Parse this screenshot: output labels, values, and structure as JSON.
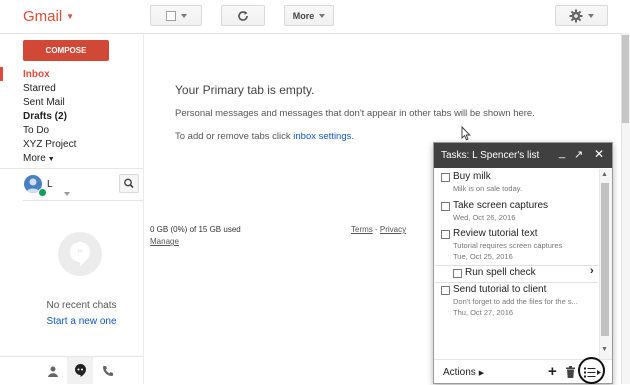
{
  "topbar": {
    "logo": "Gmail",
    "more_label": "More"
  },
  "nav": {
    "compose": "COMPOSE",
    "inbox": "Inbox",
    "starred": "Starred",
    "sent": "Sent Mail",
    "drafts": "Drafts (2)",
    "todo": "To Do",
    "xyz": "XYZ Project",
    "more": "More"
  },
  "user": {
    "name": "L"
  },
  "chat": {
    "no_chats": "No recent chats",
    "start_new": "Start a new one"
  },
  "main": {
    "empty_title": "Your Primary tab is empty.",
    "empty_desc": "Personal messages and messages that don't appear in other tabs will be shown here.",
    "tabs_prefix": "To add or remove tabs click ",
    "tabs_link": "inbox settings",
    "tabs_suffix": ".",
    "storage": "0 GB (0%) of 15 GB used",
    "manage": "Manage",
    "terms": "Terms",
    "sep": " - ",
    "privacy": "Privacy"
  },
  "tasks": {
    "title": "Tasks: L Spencer's list",
    "items": [
      {
        "title": "Buy milk",
        "note": "Milk is on sale today."
      },
      {
        "title": "Take screen captures",
        "note": "Wed, Oct 26, 2016"
      },
      {
        "title": "Review tutorial text",
        "note": "Tutorial requires screen captures",
        "date": "Tue, Oct 25, 2016"
      },
      {
        "title": "Run spell check"
      },
      {
        "title": "Send tutorial to client",
        "note": "Don't forget to add the files for the s...",
        "date": "Thu, Oct 27, 2016"
      }
    ],
    "actions": "Actions"
  },
  "colors": {
    "brand": "#dd4b39",
    "compose": "#d14836",
    "link": "#1155cc",
    "tasks_header": "#404040"
  }
}
